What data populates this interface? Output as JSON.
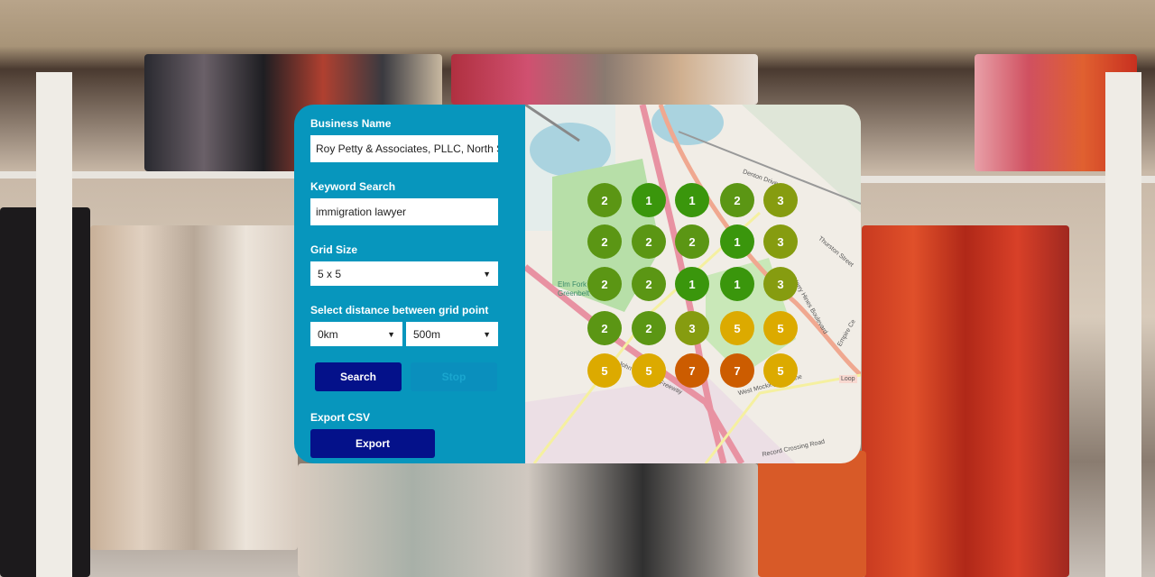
{
  "form": {
    "business_name_label": "Business Name",
    "business_name_value": "Roy Petty & Associates, PLLC, North St",
    "keyword_label": "Keyword Search",
    "keyword_value": "immigration lawyer",
    "grid_size_label": "Grid Size",
    "grid_size_value": "5 x 5",
    "distance_label": "Select distance between grid point",
    "distance_km_value": "0km",
    "distance_m_value": "500m",
    "search_label": "Search",
    "stop_label": "Stop",
    "export_csv_label": "Export CSV",
    "export_label": "Export"
  },
  "map": {
    "labels": [
      "Elm Fork",
      "Greenbelt",
      "Denton Drive",
      "Thurston Street",
      "Harry Hines Boulevard",
      "John Carpenter Freeway",
      "West Mockingbird Lane",
      "Record Crossing Road",
      "Loop",
      "Empire Ce"
    ],
    "grid_ranks": [
      [
        2,
        1,
        1,
        2,
        3
      ],
      [
        2,
        2,
        2,
        1,
        3
      ],
      [
        2,
        2,
        1,
        1,
        3
      ],
      [
        2,
        2,
        3,
        5,
        5
      ],
      [
        5,
        5,
        7,
        7,
        5
      ]
    ],
    "rank_colors": {
      "1": "#3a960c",
      "2": "#5b9614",
      "3": "#869c10",
      "5": "#dcaa00",
      "7": "#cc5c00"
    }
  },
  "colors": {
    "panel": "#0796bd",
    "button": "#04118a",
    "stop_button": "#0a8fbd"
  }
}
